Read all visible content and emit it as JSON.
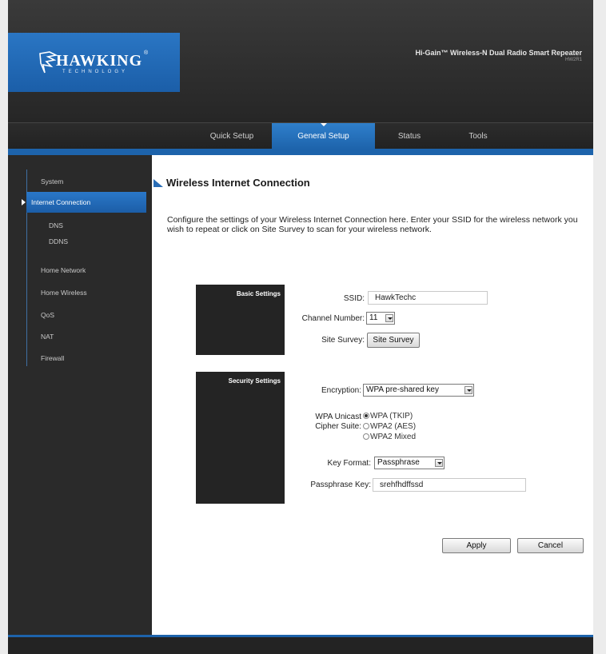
{
  "header": {
    "logo_text": "HAWKING",
    "logo_sub": "TECHNOLOGY",
    "logo_tm": "®",
    "product_title": "Hi-Gain™ Wireless-N Dual Radio Smart Repeater",
    "product_model": "HW2R1"
  },
  "nav": {
    "items": [
      {
        "label": "Quick Setup"
      },
      {
        "label": "General Setup",
        "active": true
      },
      {
        "label": "Status"
      },
      {
        "label": "Tools"
      }
    ]
  },
  "sidebar": {
    "items": [
      {
        "label": "System"
      },
      {
        "label": "Internet Connection",
        "active": true
      },
      {
        "label": "DNS"
      },
      {
        "label": "DDNS"
      },
      {
        "label": "Home Network"
      },
      {
        "label": "Home Wireless"
      },
      {
        "label": "QoS"
      },
      {
        "label": "NAT"
      },
      {
        "label": "Firewall"
      }
    ]
  },
  "main": {
    "title": "Wireless Internet Connection",
    "description": "Configure the settings of your Wireless Internet Connection here. Enter your SSID for the wireless network you wish to repeat or click on Site Survey to scan for your wireless network.",
    "basic": {
      "panel_label": "Basic Settings",
      "ssid_label": "SSID:",
      "ssid_value": "HawkTechc",
      "channel_label": "Channel Number:",
      "channel_value": "11",
      "site_survey_label": "Site Survey:",
      "site_survey_button": "Site Survey"
    },
    "security": {
      "panel_label": "Security Settings",
      "encryption_label": "Encryption:",
      "encryption_value": "WPA pre-shared key",
      "cipher_label_1": "WPA Unicast",
      "cipher_label_2": "Cipher Suite:",
      "cipher_options": [
        "WPA (TKIP)",
        "WPA2 (AES)",
        "WPA2 Mixed"
      ],
      "cipher_selected": "WPA (TKIP)",
      "key_format_label": "Key Format:",
      "key_format_value": "Passphrase",
      "passphrase_label": "Passphrase Key:",
      "passphrase_value": "srehfhdffssd"
    },
    "apply_button": "Apply",
    "cancel_button": "Cancel"
  },
  "colors": {
    "accent_blue": "#1d63ab",
    "dark_bg": "#2b2b2b",
    "panel_bg": "#242424"
  }
}
